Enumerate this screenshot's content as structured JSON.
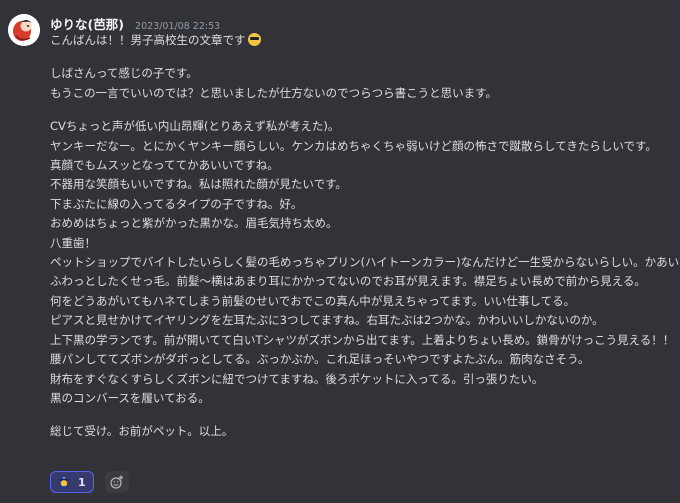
{
  "message": {
    "username": "ゆりな(芭那)",
    "timestamp": "2023/01/08 22:53",
    "avatar_icon": "character-avatar-icon",
    "lines": [
      "こんばんは！！男子高校生の文章です",
      "",
      "しばさんって感じの子です。",
      "もうこの一言でいいのでは？と思いましたが仕方ないのでつらつら書こうと思います。",
      "",
      "CVちょっと声が低い内山昂輝(とりあえず私が考えた)。",
      "ヤンキーだなー。とにかくヤンキー顔らしい。ケンカはめちゃくちゃ弱いけど顔の怖さで蹴散らしてきたらしいです。",
      "真顔でもムスッとなっててかあいいですね。",
      "不器用な笑顔もいいですね。私は照れた顔が見たいです。",
      "下まぶたに線の入ってるタイプの子ですね。好。",
      "おめめはちょっと紫がかった黒かな。眉毛気持ち太め。",
      "八重歯！",
      "ペットショップでバイトしたいらしく髪の毛めっちゃプリン(ハイトーンカラー)なんだけど一生受からないらしい。かあいいね。",
      "ふわっとしたくせっ毛。前髪〜横はあまり耳にかかってないのでお耳が見えます。襟足ちょい長めで前から見える。",
      "何をどうあがいてもハネてしまう前髪のせいでおでこの真ん中が見えちゃってます。いい仕事してる。",
      "ピアスと見せかけてイヤリングを左耳たぶに3つしてますね。右耳たぶは2つかな。かわいいしかないのか。",
      "上下黒の学ランです。前が開いてて白いTシャツがズボンから出てます。上着よりちょい長め。鎖骨がけっこう見える！！",
      "腰パンしててズボンがダボっとしてる。ぶっかぶか。これ足ほっそいやつですよたぶん。筋肉なさそう。",
      "財布をすぐなくすらしくズボンに紐でつけてますね。後ろポケットに入ってる。引っ張りたい。",
      "黒のコンバースを履いておる。",
      "",
      "総じて受け。お前がペット。以上。"
    ],
    "greeting_emoji": "sunglasses-emoji-icon",
    "reactions": [
      {
        "emoji": "police-officer-emoji-icon",
        "count": "1",
        "active": true
      }
    ],
    "add_reaction_icon": "add-reaction-icon"
  },
  "colors": {
    "background": "#313338",
    "text": "#dbdee1",
    "username": "#f2f3f5",
    "timestamp": "#949ba4",
    "reaction_active_bg": "#373a6d",
    "reaction_active_border": "#5865f2"
  }
}
